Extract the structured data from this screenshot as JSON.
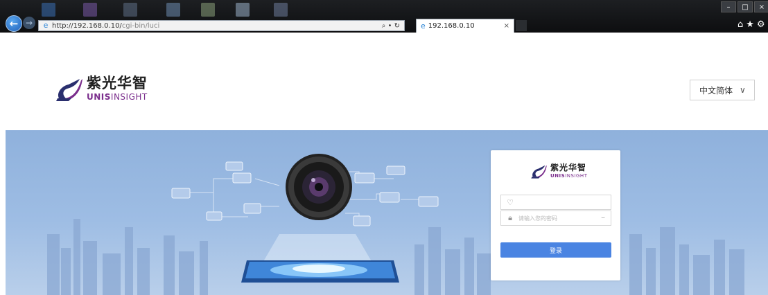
{
  "browser": {
    "address_url": "http://192.168.0.10/",
    "address_url_path": "cgi-bin/luci",
    "address_tools": "⌕ • ↻",
    "tab_title": "192.168.0.10",
    "tab_close": "×",
    "window_controls": [
      "–",
      "□",
      "×"
    ],
    "toolbar_icons": "⌂★⚙"
  },
  "header": {
    "brand_cn": "紫光华智",
    "brand_en_bold": "UNIS",
    "brand_en_rest": "INSIGHT",
    "language": "中文简体",
    "language_chevron": "∨"
  },
  "login": {
    "brand_cn": "紫光华智",
    "brand_en_bold": "UNIS",
    "brand_en_rest": "INSIGHT",
    "username_value": "",
    "username_placeholder": "",
    "password_placeholder": "请输入您的密码",
    "submit_label": "登录"
  },
  "colors": {
    "brand_purple": "#7a2d8c",
    "brand_navy": "#2a2f6e",
    "accent_blue": "#4a84e2",
    "banner_blue": "#9ebde4"
  }
}
